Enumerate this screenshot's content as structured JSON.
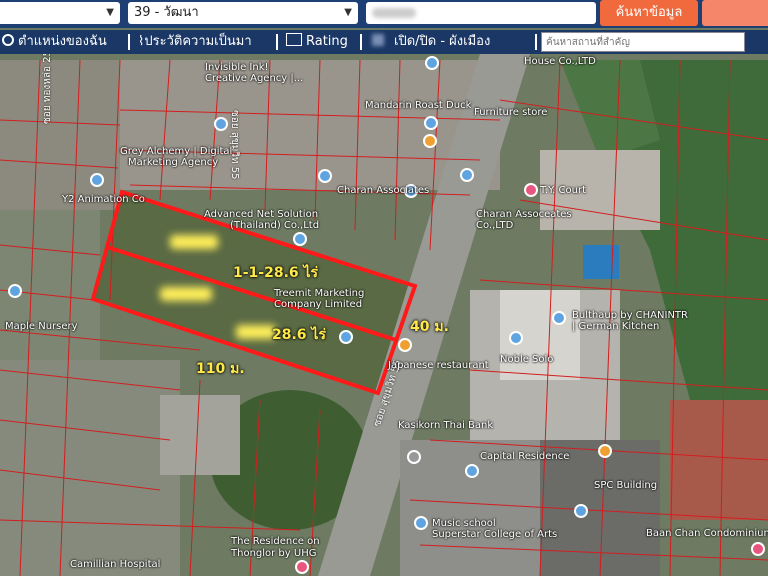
{
  "topbar": {
    "select_left": "",
    "select_soi": "39 - วัฒนา",
    "search_button": "ค้นหาข้อมูล"
  },
  "navbar": {
    "my_location": "ตำแหน่งของฉัน",
    "history": "ประวัติความเป็นมา",
    "rating": "Rating",
    "zoning": "เปิด/ปิด - ผังเมือง",
    "search_placeholder": "ค้นหาสถานที่สำคัญ"
  },
  "map": {
    "labels": {
      "invisible_ink": "Invisible Ink! ",
      "creative_agency": "Creative Agency |...",
      "mandarin": "Mandarin Roast Duck",
      "furniture": "Furniture store",
      "house_co": "House Co.,LTD",
      "grey_alchemy": "Grey Alchemy | Digital",
      "marketing_agency": "Marketing Agency",
      "charan_assoc_small": "Charan Associates",
      "ty_court": "T.Y. Court",
      "y2": "Y2 Animation Co",
      "advanced_net": "Advanced Net Solution",
      "advanced_net2": "(Thailand) Co.,Ltd",
      "charan_assoc": "Charan Assoceates",
      "charan_assoc2": "Co.,LTD",
      "treemit": "Treemit Marketing",
      "treemit2": "Company Limited",
      "maple": "Maple Nursery",
      "bulthaup": "Bulthaup by CHANINTR",
      "bulthaup2": "| German Kitchen",
      "noble": "Noble Solo",
      "japanese": "Japanese restaurant",
      "kasikorn": "Kasikorn Thai Bank",
      "capital": "Capital Residence",
      "spc": "SPC Building",
      "music": "Music school",
      "superstar": "Superstar College of Arts",
      "residence": "The Residence on",
      "residence2": "Thonglor by UHG",
      "baan_chan": "Baan Chan Condominium",
      "camillian": "Camillian Hospital"
    },
    "roads": {
      "soi55_top": "ซอย สุขุมวิท 55",
      "soi55_bottom": "ซอย สุขุมวิท 55",
      "soi_left": "ซอย ทองหล่อ 25"
    },
    "measurements": {
      "area_total": "1-1-28.6 ไร่",
      "area_part": "28.6 ไร่",
      "frontage": "40 ม.",
      "depth": "110 ม."
    },
    "colors": {
      "plot_outline": "#ff1a1a",
      "parcel_lines": "#d21e1e",
      "measure_text": "#ffe94a"
    }
  }
}
